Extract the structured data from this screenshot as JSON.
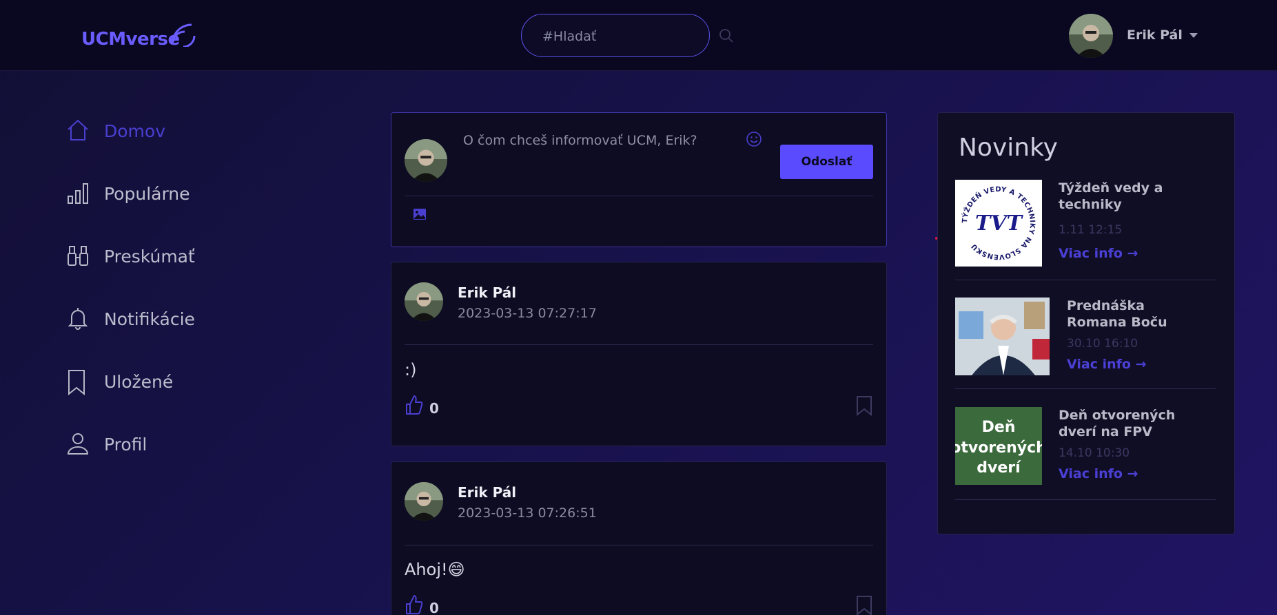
{
  "header": {
    "logo": "UCMverse",
    "search_placeholder": "#Hladať",
    "user_name": "Erik Pál"
  },
  "sidebar": {
    "items": [
      {
        "label": "Domov",
        "icon": "home-icon",
        "active": true
      },
      {
        "label": "Populárne",
        "icon": "bar-chart-icon"
      },
      {
        "label": "Preskúmať",
        "icon": "binoculars-icon"
      },
      {
        "label": "Notifikácie",
        "icon": "bell-icon"
      },
      {
        "label": "Uložené",
        "icon": "bookmark-icon"
      },
      {
        "label": "Profil",
        "icon": "person-icon"
      }
    ]
  },
  "composer": {
    "placeholder": "O čom chceš informovať UCM, Erik?",
    "send_label": "Odoslať"
  },
  "posts": [
    {
      "author": "Erik Pál",
      "date": "2023-03-13 07:27:17",
      "text": ":)",
      "likes": "0"
    },
    {
      "author": "Erik Pál",
      "date": "2023-03-13 07:26:51",
      "text": "Ahoj!😄",
      "likes": "0"
    }
  ],
  "news": {
    "title": "Novinky",
    "items": [
      {
        "title": "Týždeň vedy a techniky",
        "time": "1.11 12:15",
        "link": "Viac info →"
      },
      {
        "title": "Prednáška Romana Boču",
        "time": "30.10 16:10",
        "link": "Viac info →"
      },
      {
        "title": "Deň otvorených dverí na FPV",
        "time": "14.10 10:30",
        "link": "Viac info →"
      }
    ],
    "thumb1_ring": "TÝŽDEŇ VEDY A TECHNIKY NA SLOVENSKU",
    "thumb1_logo": "TVT",
    "thumb3_lines": [
      "Deň",
      "otvorených",
      "dverí"
    ]
  },
  "colors": {
    "accent": "#5a4bff",
    "logo": "#6a5cff",
    "background": "#17124a"
  }
}
